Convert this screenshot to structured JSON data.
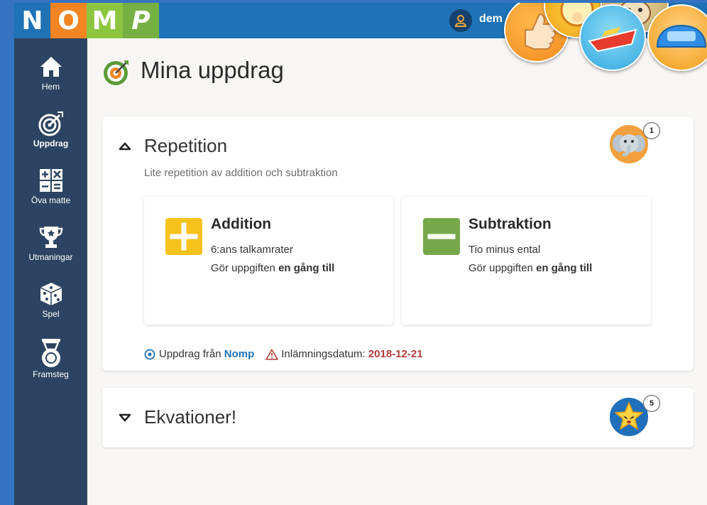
{
  "logo": {
    "letters": [
      "N",
      "O",
      "M",
      "P"
    ],
    "colors": [
      "#1e72b5",
      "#f28522",
      "#8cc63f",
      "#76b043"
    ]
  },
  "user": {
    "name": "dem"
  },
  "sidebar": {
    "items": [
      {
        "label": "Hem",
        "icon": "home-icon"
      },
      {
        "label": "Uppdrag",
        "icon": "target-icon"
      },
      {
        "label": "Öva matte",
        "icon": "calculator-icon"
      },
      {
        "label": "Utmaningar",
        "icon": "trophy-icon"
      },
      {
        "label": "Spel",
        "icon": "dice-icon"
      },
      {
        "label": "Framsteg",
        "icon": "medal-icon"
      }
    ]
  },
  "page": {
    "title": "Mina uppdrag"
  },
  "missions": [
    {
      "title": "Repetition",
      "description": "Lite repetition av addition och subtraktion",
      "badge_count": "1",
      "tasks": [
        {
          "title": "Addition",
          "subtitle": "6:ans talkamrater",
          "retry_prefix": "Gör uppgiften",
          "retry_bold": "en gång till"
        },
        {
          "title": "Subtraktion",
          "subtitle": "Tio minus ental",
          "retry_prefix": "Gör uppgiften",
          "retry_bold": "en gång till"
        }
      ],
      "from_label": "Uppdrag från",
      "from_name": "Nomp",
      "due_label": "Inlämningsdatum:",
      "due_date": "2018-12-21"
    },
    {
      "title": "Ekvationer!",
      "badge_count": "5"
    }
  ],
  "colors": {
    "topbar": "#1e72b5",
    "sidebar": "#2c4461",
    "addition": "#f8c21d",
    "subtraction": "#76a84a",
    "link": "#1e72b5",
    "date": "#b23b3b"
  }
}
